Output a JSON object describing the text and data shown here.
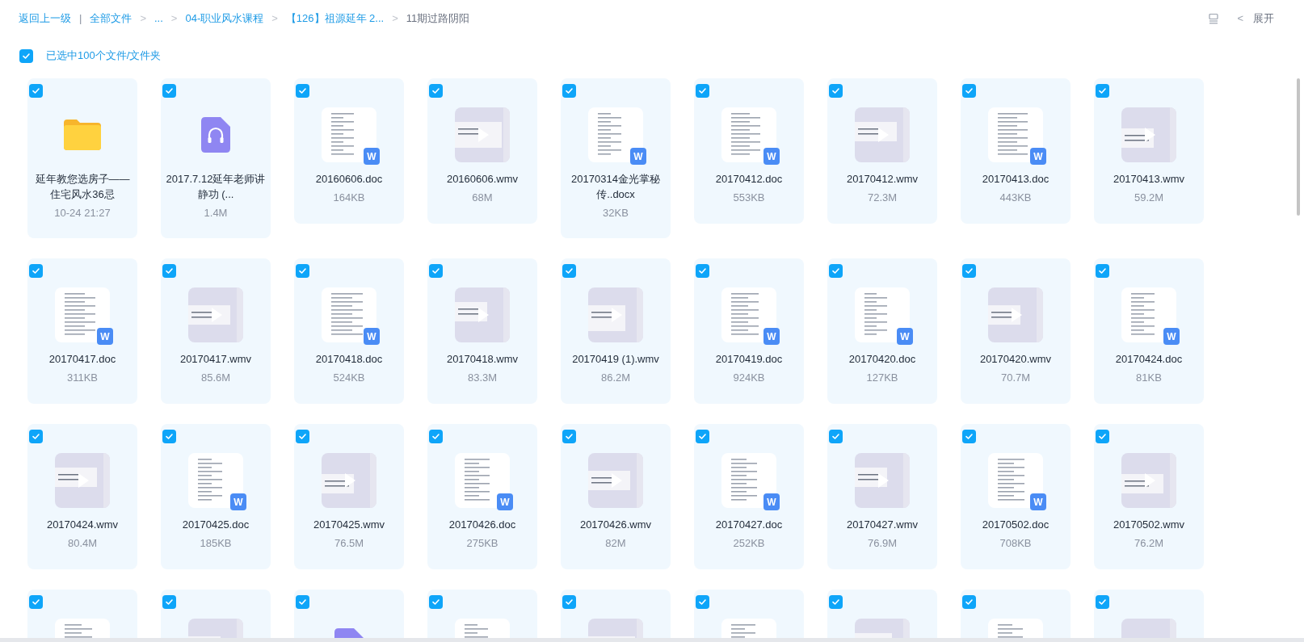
{
  "breadcrumb": {
    "back": "返回上一级",
    "separator": "|",
    "items": [
      {
        "label": "全部文件",
        "current": false
      },
      {
        "label": "...",
        "current": false
      },
      {
        "label": "04-职业风水课程",
        "current": false
      },
      {
        "label": "【126】祖源延年 2...",
        "current": false
      },
      {
        "label": "11期过路阴阳",
        "current": true
      }
    ],
    "arrow": ">"
  },
  "header_right": {
    "collapse_arrow": "<",
    "expand": "展开"
  },
  "select_all": {
    "checked": true,
    "label": "已选中100个文件/文件夹"
  },
  "items": [
    {
      "kind": "folder",
      "name": "延年教您选房子——住宅风水36忌",
      "meta": "10-24 21:27",
      "selected": true
    },
    {
      "kind": "audio",
      "name": "2017.7.12延年老师讲静功 (...",
      "meta": "1.4M",
      "selected": true
    },
    {
      "kind": "doc",
      "name": "20160606.doc",
      "meta": "164KB",
      "badge": "W",
      "selected": true
    },
    {
      "kind": "video",
      "name": "20160606.wmv",
      "meta": "68M",
      "selected": true
    },
    {
      "kind": "doc",
      "name": "20170314金光掌秘传..docx",
      "meta": "32KB",
      "badge": "W",
      "selected": true
    },
    {
      "kind": "doc",
      "name": "20170412.doc",
      "meta": "553KB",
      "badge": "W",
      "selected": true
    },
    {
      "kind": "video",
      "name": "20170412.wmv",
      "meta": "72.3M",
      "selected": true
    },
    {
      "kind": "doc",
      "name": "20170413.doc",
      "meta": "443KB",
      "badge": "W",
      "selected": true
    },
    {
      "kind": "video",
      "name": "20170413.wmv",
      "meta": "59.2M",
      "selected": true
    },
    {
      "kind": "doc",
      "name": "20170417.doc",
      "meta": "311KB",
      "badge": "W",
      "selected": true
    },
    {
      "kind": "video",
      "name": "20170417.wmv",
      "meta": "85.6M",
      "selected": true
    },
    {
      "kind": "doc",
      "name": "20170418.doc",
      "meta": "524KB",
      "badge": "W",
      "selected": true
    },
    {
      "kind": "video",
      "name": "20170418.wmv",
      "meta": "83.3M",
      "selected": true
    },
    {
      "kind": "video",
      "name": "20170419 (1).wmv",
      "meta": "86.2M",
      "selected": true
    },
    {
      "kind": "doc",
      "name": "20170419.doc",
      "meta": "924KB",
      "badge": "W",
      "selected": true
    },
    {
      "kind": "doc",
      "name": "20170420.doc",
      "meta": "127KB",
      "badge": "W",
      "selected": true
    },
    {
      "kind": "video",
      "name": "20170420.wmv",
      "meta": "70.7M",
      "selected": true
    },
    {
      "kind": "doc",
      "name": "20170424.doc",
      "meta": "81KB",
      "badge": "W",
      "selected": true
    },
    {
      "kind": "video",
      "name": "20170424.wmv",
      "meta": "80.4M",
      "selected": true
    },
    {
      "kind": "doc",
      "name": "20170425.doc",
      "meta": "185KB",
      "badge": "W",
      "selected": true
    },
    {
      "kind": "video",
      "name": "20170425.wmv",
      "meta": "76.5M",
      "selected": true
    },
    {
      "kind": "doc",
      "name": "20170426.doc",
      "meta": "275KB",
      "badge": "W",
      "selected": true
    },
    {
      "kind": "video",
      "name": "20170426.wmv",
      "meta": "82M",
      "selected": true
    },
    {
      "kind": "doc",
      "name": "20170427.doc",
      "meta": "252KB",
      "badge": "W",
      "selected": true
    },
    {
      "kind": "video",
      "name": "20170427.wmv",
      "meta": "76.9M",
      "selected": true
    },
    {
      "kind": "doc",
      "name": "20170502.doc",
      "meta": "708KB",
      "badge": "W",
      "selected": true
    },
    {
      "kind": "video",
      "name": "20170502.wmv",
      "meta": "76.2M",
      "selected": true
    },
    {
      "kind": "doc",
      "selected": true
    },
    {
      "kind": "video",
      "selected": true
    },
    {
      "kind": "audio",
      "selected": true
    },
    {
      "kind": "doc",
      "selected": true
    },
    {
      "kind": "video",
      "selected": true
    },
    {
      "kind": "doc",
      "selected": true
    },
    {
      "kind": "video",
      "selected": true
    },
    {
      "kind": "doc",
      "selected": true
    },
    {
      "kind": "video",
      "selected": true
    }
  ]
}
